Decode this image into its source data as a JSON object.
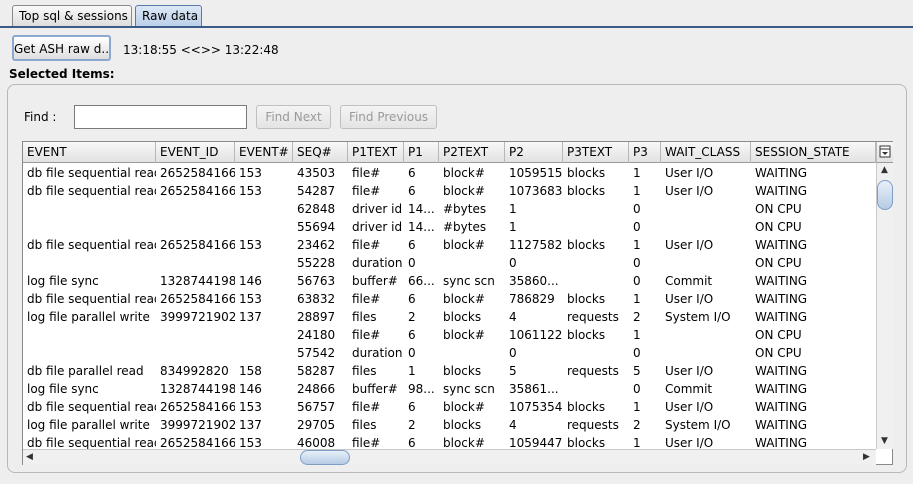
{
  "tabs": [
    {
      "label": "Top sql & sessions",
      "active": false
    },
    {
      "label": "Raw data",
      "active": true
    }
  ],
  "toolbar": {
    "get_ash_label": "Get ASH raw d...",
    "time_range": "13:18:55 <<>> 13:22:48"
  },
  "selected_items_label": "Selected Items:",
  "find": {
    "label": "Find :",
    "value": "",
    "find_next_label": "Find Next",
    "find_previous_label": "Find Previous"
  },
  "table": {
    "columns": [
      "EVENT",
      "EVENT_ID",
      "EVENT#",
      "SEQ#",
      "P1TEXT",
      "P1",
      "P2TEXT",
      "P2",
      "P3TEXT",
      "P3",
      "WAIT_CLASS",
      "SESSION_STATE"
    ],
    "rows": [
      [
        "db file sequential read",
        "2652584166",
        "153",
        "43503",
        "file#",
        "6",
        "block#",
        "1059515",
        "blocks",
        "1",
        "User I/O",
        "WAITING"
      ],
      [
        "db file sequential read",
        "2652584166",
        "153",
        "54287",
        "file#",
        "6",
        "block#",
        "1073683",
        "blocks",
        "1",
        "User I/O",
        "WAITING"
      ],
      [
        "",
        "",
        "",
        "62848",
        "driver id",
        "14...",
        "#bytes",
        "1",
        "",
        "0",
        "",
        "ON CPU"
      ],
      [
        "",
        "",
        "",
        "55694",
        "driver id",
        "14...",
        "#bytes",
        "1",
        "",
        "0",
        "",
        "ON CPU"
      ],
      [
        "db file sequential read",
        "2652584166",
        "153",
        "23462",
        "file#",
        "6",
        "block#",
        "1127582",
        "blocks",
        "1",
        "User I/O",
        "WAITING"
      ],
      [
        "",
        "",
        "",
        "55228",
        "duration",
        "0",
        "",
        "0",
        "",
        "0",
        "",
        "ON CPU"
      ],
      [
        "log file sync",
        "1328744198",
        "146",
        "56763",
        "buffer#",
        "66...",
        "sync scn",
        "35860...",
        "",
        "0",
        "Commit",
        "WAITING"
      ],
      [
        "db file sequential read",
        "2652584166",
        "153",
        "63832",
        "file#",
        "6",
        "block#",
        "786829",
        "blocks",
        "1",
        "User I/O",
        "WAITING"
      ],
      [
        "log file parallel write",
        "3999721902",
        "137",
        "28897",
        "files",
        "2",
        "blocks",
        "4",
        "requests",
        "2",
        "System I/O",
        "WAITING"
      ],
      [
        "",
        "",
        "",
        "24180",
        "file#",
        "6",
        "block#",
        "1061122",
        "blocks",
        "1",
        "",
        "ON CPU"
      ],
      [
        "",
        "",
        "",
        "57542",
        "duration",
        "0",
        "",
        "0",
        "",
        "0",
        "",
        "ON CPU"
      ],
      [
        "db file parallel read",
        "834992820",
        "158",
        "58287",
        "files",
        "1",
        "blocks",
        "5",
        "requests",
        "5",
        "User I/O",
        "WAITING"
      ],
      [
        "log file sync",
        "1328744198",
        "146",
        "24866",
        "buffer#",
        "98...",
        "sync scn",
        "35861...",
        "",
        "0",
        "Commit",
        "WAITING"
      ],
      [
        "db file sequential read",
        "2652584166",
        "153",
        "56757",
        "file#",
        "6",
        "block#",
        "1075354",
        "blocks",
        "1",
        "User I/O",
        "WAITING"
      ],
      [
        "log file parallel write",
        "3999721902",
        "137",
        "29705",
        "files",
        "2",
        "blocks",
        "4",
        "requests",
        "2",
        "System I/O",
        "WAITING"
      ],
      [
        "db file sequential read",
        "2652584166",
        "153",
        "46008",
        "file#",
        "6",
        "block#",
        "1059447",
        "blocks",
        "1",
        "User I/O",
        "WAITING"
      ]
    ]
  },
  "icons": {
    "column_chooser": "column-chooser-icon",
    "scroll_up": "scroll-up-arrow-icon",
    "scroll_down": "scroll-down-arrow-icon",
    "scroll_left": "scroll-left-arrow-icon",
    "scroll_right": "scroll-right-arrow-icon"
  }
}
